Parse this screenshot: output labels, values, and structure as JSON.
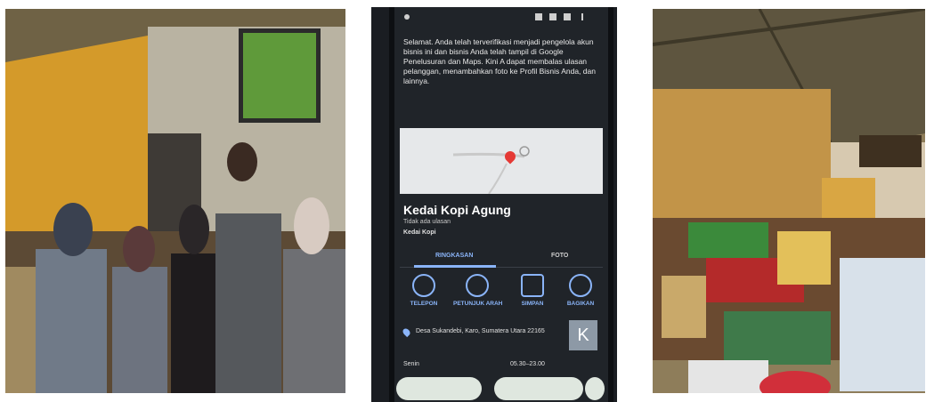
{
  "phone": {
    "message": "Selamat. Anda telah terverifikasi menjadi pengelola akun bisnis ini dan bisnis Anda telah tampil di Google Penelusuran dan Maps. Kini A dapat membalas ulasan pelanggan, menambahkan foto ke Profil Bisnis Anda, dan lainnya.",
    "business_name": "Kedai Kopi Agung",
    "reviews": "Tidak ada ulasan",
    "category": "Kedai Kopi",
    "tab_overview": "RINGKASAN",
    "tab_photos": "FOTO",
    "action_call": "TELEPON",
    "action_directions": "PETUNJUK ARAH",
    "action_save": "SIMPAN",
    "action_share": "BAGIKAN",
    "address": "Desa Sukandebi, Karo, Sumatera Utara 22165",
    "logo_letter": "K",
    "hours_day": "Senin",
    "hours_time": "05.30–23.00",
    "colors": {
      "accent": "#8ab4f8",
      "screen": "#202429",
      "pin": "#e53935"
    }
  }
}
